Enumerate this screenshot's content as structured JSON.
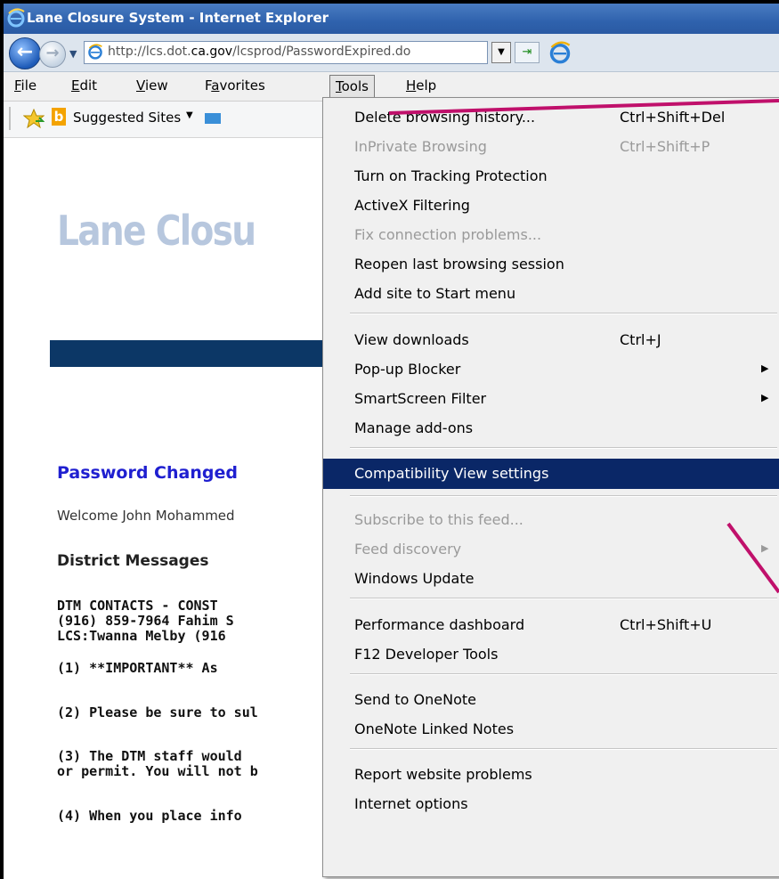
{
  "window": {
    "title": "Lane Closure System - Internet Explorer"
  },
  "address_bar": {
    "url_prefix": "http://lcs.dot.",
    "url_domain": "ca.gov",
    "url_suffix": "/lcsprod/PasswordExpired.do"
  },
  "menubar": {
    "items": [
      {
        "label": "File",
        "accel": "F",
        "rest": "ile"
      },
      {
        "label": "Edit",
        "accel": "E",
        "rest": "dit"
      },
      {
        "label": "View",
        "accel": "V",
        "rest": "iew"
      },
      {
        "label": "Favorites",
        "pre": "F",
        "accel": "a",
        "rest": "vorites"
      },
      {
        "label": "Tools",
        "accel": "T",
        "rest": "ools"
      },
      {
        "label": "Help",
        "accel": "H",
        "rest": "elp"
      }
    ]
  },
  "favorites_bar": {
    "suggested_sites": "Suggested Sites"
  },
  "page": {
    "logo_text": "Lane Closu",
    "heading": "Password Changed",
    "welcome": "Welcome John Mohammed",
    "district_messages": "District Messages",
    "lines": [
      "DTM CONTACTS - CONST",
      "(916) 859-7964 Fahim S",
      "LCS:Twanna Melby (916",
      "(1) **IMPORTANT** As",
      "(2) Please be sure to sul",
      "(3) The DTM staff would",
      "or permit. You will not b",
      "(4) When you place info"
    ]
  },
  "tools_menu": {
    "items": [
      {
        "label": "Delete browsing history...",
        "shortcut": "Ctrl+Shift+Del",
        "enabled": true
      },
      {
        "label": "InPrivate Browsing",
        "shortcut": "Ctrl+Shift+P",
        "enabled": false
      },
      {
        "label": "Turn on Tracking Protection",
        "enabled": true
      },
      {
        "label": "ActiveX Filtering",
        "enabled": true
      },
      {
        "label": "Fix connection problems...",
        "enabled": false
      },
      {
        "label": "Reopen last browsing session",
        "enabled": true
      },
      {
        "label": "Add site to Start menu",
        "enabled": true
      },
      {
        "label": "View downloads",
        "shortcut": "Ctrl+J",
        "enabled": true
      },
      {
        "label": "Pop-up Blocker",
        "submenu": true,
        "enabled": true
      },
      {
        "label": "SmartScreen Filter",
        "submenu": true,
        "enabled": true
      },
      {
        "label": "Manage add-ons",
        "enabled": true
      },
      {
        "label": "Compatibility View settings",
        "enabled": true,
        "highlighted": true
      },
      {
        "label": "Subscribe to this feed...",
        "enabled": false
      },
      {
        "label": "Feed discovery",
        "submenu": true,
        "enabled": false
      },
      {
        "label": "Windows Update",
        "enabled": true
      },
      {
        "label": "Performance dashboard",
        "shortcut": "Ctrl+Shift+U",
        "enabled": true
      },
      {
        "label": "F12 Developer Tools",
        "enabled": true
      },
      {
        "label": "Send to OneNote",
        "enabled": true
      },
      {
        "label": "OneNote Linked Notes",
        "enabled": true
      },
      {
        "label": "Report website problems",
        "enabled": true
      },
      {
        "label": "Internet options",
        "enabled": true
      }
    ]
  },
  "colors": {
    "title_bar": "#3a6cb8",
    "menu_highlight": "#0a2767",
    "page_heading": "#1f1fd0",
    "annotation": "#c0106b",
    "banner": "#0c3766"
  },
  "icons": {
    "browser": "ie-logo-icon",
    "back": "back-arrow-icon",
    "forward": "forward-arrow-icon",
    "refresh": "refresh-icon",
    "favorites": "favorites-star-icon",
    "bing": "bing-icon"
  }
}
